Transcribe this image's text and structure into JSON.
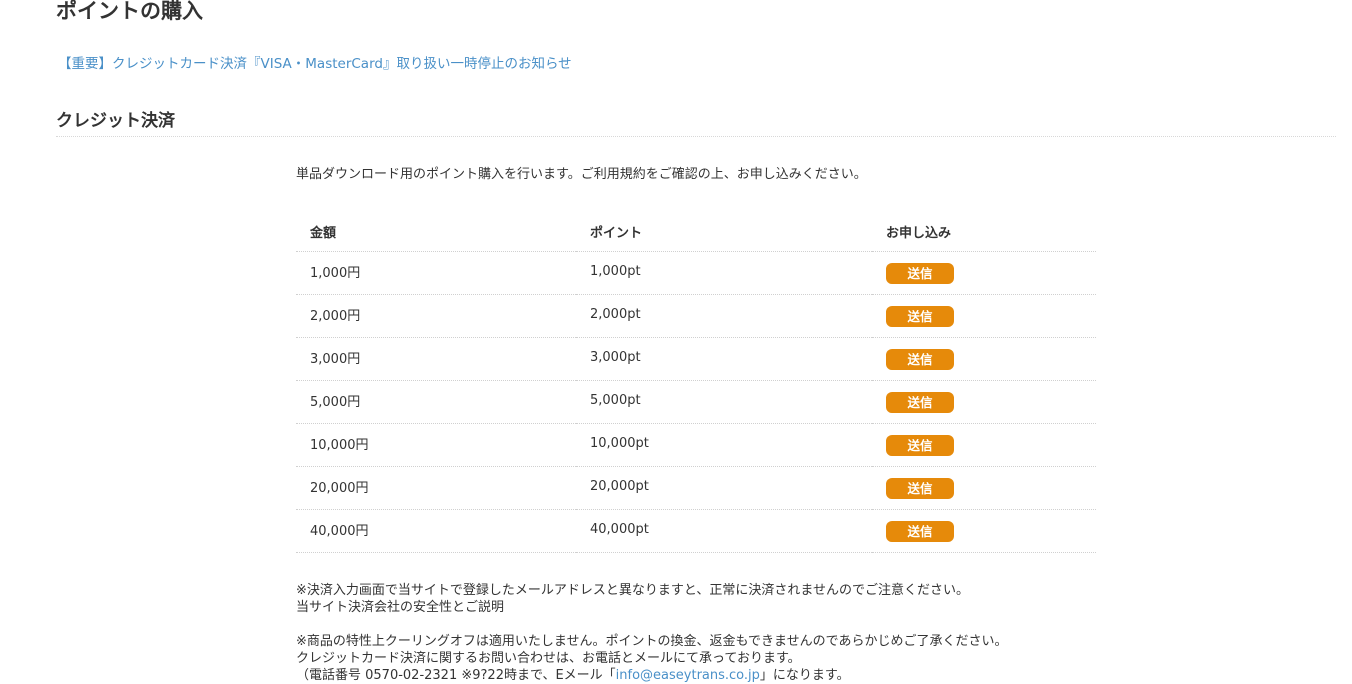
{
  "page": {
    "title": "ポイントの購入",
    "notice_link": "【重要】クレジットカード決済『VISA・MasterCard』取り扱い一時停止のお知らせ"
  },
  "credit": {
    "heading": "クレジット決済",
    "intro": "単品ダウンロード用のポイント購入を行います。ご利用規約をご確認の上、お申し込みください。",
    "table": {
      "headers": {
        "amount": "金額",
        "points": "ポイント",
        "apply": "お申し込み"
      },
      "rows": [
        {
          "amount": "1,000円",
          "points": "1,000pt",
          "button": "送信"
        },
        {
          "amount": "2,000円",
          "points": "2,000pt",
          "button": "送信"
        },
        {
          "amount": "3,000円",
          "points": "3,000pt",
          "button": "送信"
        },
        {
          "amount": "5,000円",
          "points": "5,000pt",
          "button": "送信"
        },
        {
          "amount": "10,000円",
          "points": "10,000pt",
          "button": "送信"
        },
        {
          "amount": "20,000円",
          "points": "20,000pt",
          "button": "送信"
        },
        {
          "amount": "40,000円",
          "points": "40,000pt",
          "button": "送信"
        }
      ]
    }
  },
  "notes": {
    "email_warning": "※決済入力画面で当サイトで登録したメールアドレスと異なりますと、正常に決済されませんのでご注意ください。",
    "security_explanation": "当サイト決済会社の安全性とご説明",
    "no_cooling_off": "※商品の特性上クーリングオフは適用いたしません。ポイントの換金、返金もできませんのであらかじめご了承ください。",
    "contact_intro": "クレジットカード決済に関するお問い合わせは、お電話とメールにて承っております。",
    "contact_prefix": "（電話番号 0570-02-2321 ※9?22時まで、Eメール「",
    "contact_email": "info@easeytrans.co.jp",
    "contact_suffix": "」になります。"
  },
  "colors": {
    "accent_button": "#e68a0a",
    "link": "#4a90c8",
    "text": "#333333"
  }
}
